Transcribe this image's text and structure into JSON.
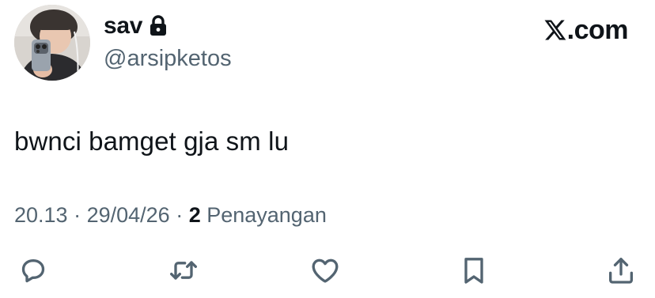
{
  "author": {
    "display_name": "sav",
    "handle": "@arsipketos",
    "protected_icon": "lock-icon",
    "avatar_icon": "profile-photo"
  },
  "brand": {
    "logo_icon": "x-logo-icon",
    "domain_suffix": ".com"
  },
  "tweet": {
    "text": "bwnci bamget gja sm lu"
  },
  "meta": {
    "time": "20.13",
    "separator_1": " · ",
    "date": "29/04/26",
    "separator_2": " · ",
    "views_count": "2",
    "views_label": " Penayangan"
  },
  "actions": [
    {
      "icon": "reply-icon"
    },
    {
      "icon": "retweet-icon"
    },
    {
      "icon": "like-icon"
    },
    {
      "icon": "bookmark-icon"
    },
    {
      "icon": "share-icon"
    }
  ],
  "colors": {
    "text_primary": "#0f1419",
    "text_secondary": "#536471",
    "icon": "#536471"
  }
}
